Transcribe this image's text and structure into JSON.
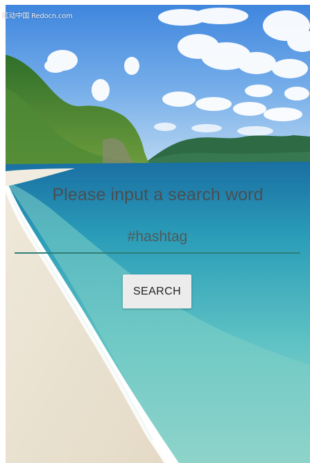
{
  "watermark": "红动中国 Redocn.com",
  "search_prompt": "Please input a search word",
  "search_input": {
    "value": "",
    "placeholder": "#hashtag"
  },
  "search_button_label": "SEARCH",
  "colors": {
    "input_underline": "#2f7f78",
    "button_background": "#ececec",
    "prompt_text": "#4a4e52"
  }
}
